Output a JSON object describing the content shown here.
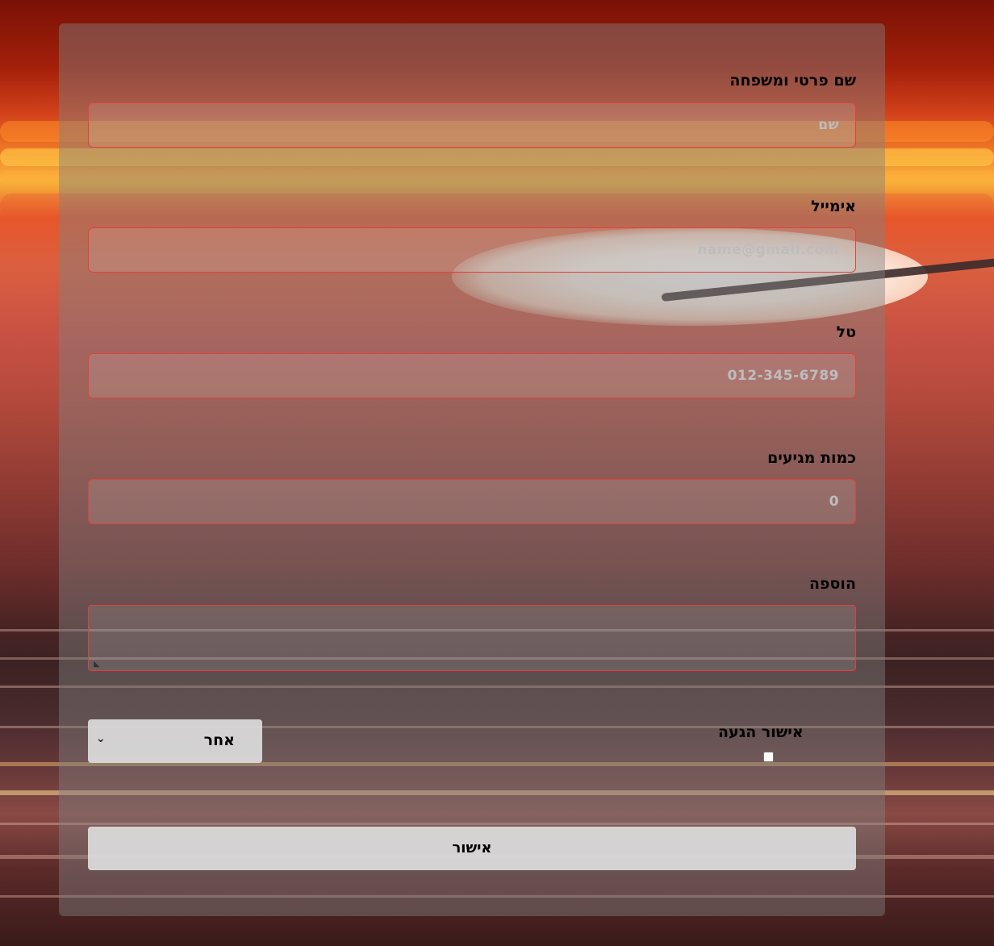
{
  "form": {
    "name": {
      "label": "שם פרטי ומשפחה",
      "placeholder": "שם"
    },
    "email": {
      "label": "אימייל",
      "placeholder": "name@gmail.com"
    },
    "phone": {
      "label": "טל",
      "placeholder": "012-345-6789"
    },
    "guests": {
      "label": "כמות מגיעים",
      "placeholder": "0"
    },
    "notes": {
      "label": "הוספה",
      "placeholder": ""
    },
    "arrival_confirm": {
      "label": "אישור הגעה",
      "checked": false
    },
    "relation_select": {
      "selected": "אחר"
    },
    "submit": {
      "label": "אישור"
    }
  },
  "icons": {
    "select_chevron": "chevron-down-icon",
    "resize": "resize-grip-icon"
  },
  "colors": {
    "input_border": "#e3403a",
    "card_overlay": "rgba(128,128,128,0.45)",
    "button_bg": "#dcdcdc"
  }
}
